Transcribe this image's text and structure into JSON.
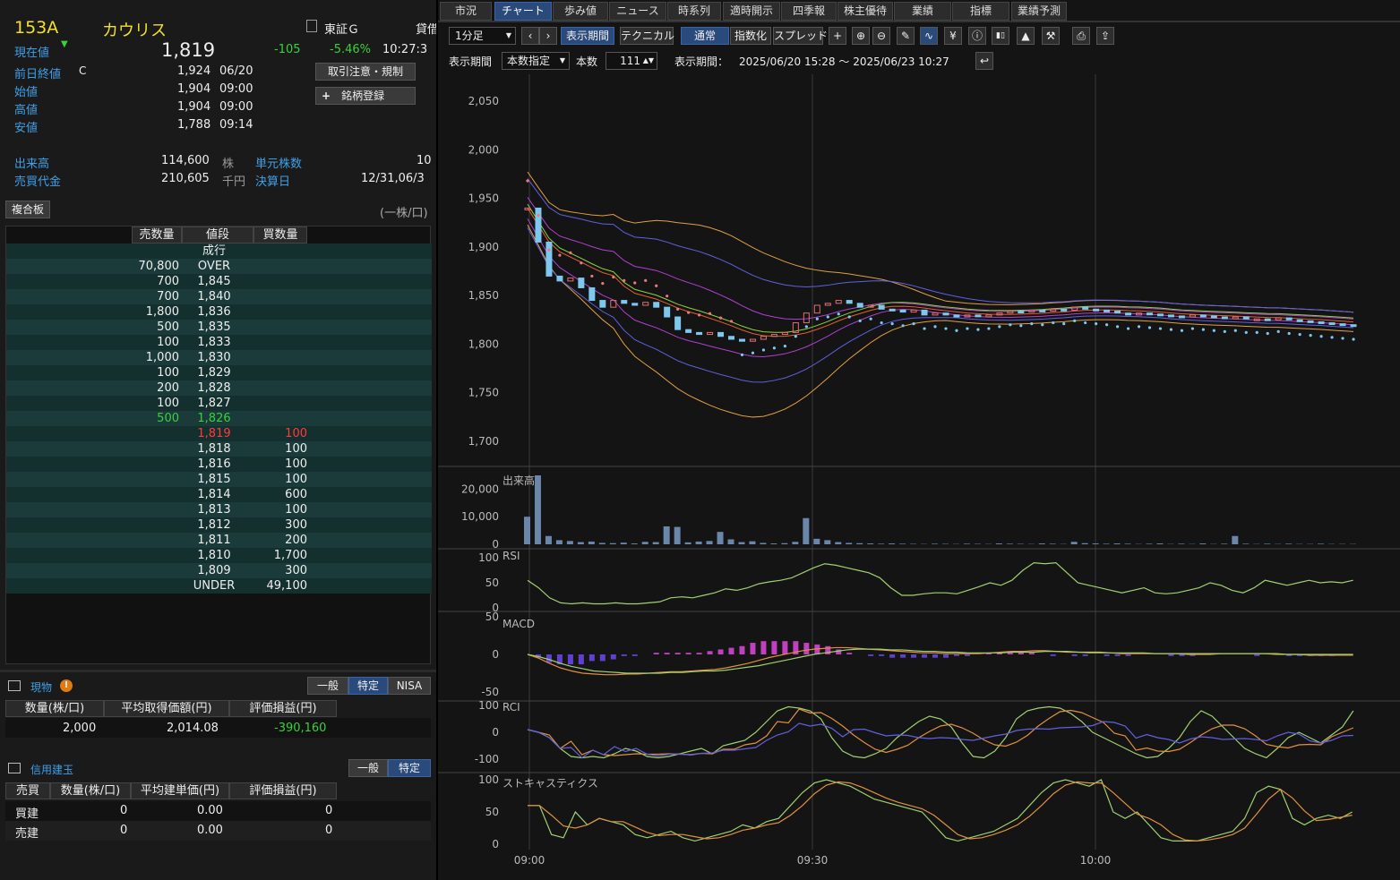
{
  "quote": {
    "code": "153A",
    "name": "カウリス",
    "market": "東証Ｇ",
    "lending": "貸借",
    "price_label": "現在値",
    "price": "1,819",
    "change": "-105",
    "change_pct": "-5.46%",
    "time": "10:27:3",
    "prev_label": "前日終値",
    "prev_flag": "C",
    "prev": "1,924",
    "prev_date": "06/20",
    "open_label": "始値",
    "open": "1,904",
    "open_time": "09:00",
    "high_label": "高値",
    "high": "1,904",
    "high_time": "09:00",
    "low_label": "安値",
    "low": "1,788",
    "low_time": "09:14",
    "vol_label": "出来高",
    "vol": "114,600",
    "vol_unit": "株",
    "turnover_label": "売買代金",
    "turnover": "210,605",
    "turnover_unit": "千円",
    "unit_label": "単元株数",
    "unit_value": "10",
    "settle_label": "決算日",
    "settle_value": "12/31,06/3",
    "btn_caution": "取引注意・規制",
    "btn_register": "銘柄登録"
  },
  "board": {
    "title": "複合板",
    "unit": "(一株/口)",
    "headers": [
      "売数量",
      "値段",
      "買数量"
    ],
    "rows": [
      {
        "sell": "",
        "price": "成行",
        "buy": "",
        "color": "w"
      },
      {
        "sell": "70,800",
        "price": "OVER",
        "buy": "",
        "color": "w"
      },
      {
        "sell": "700",
        "price": "1,845",
        "buy": "",
        "color": "w"
      },
      {
        "sell": "700",
        "price": "1,840",
        "buy": "",
        "color": "w"
      },
      {
        "sell": "1,800",
        "price": "1,836",
        "buy": "",
        "color": "w"
      },
      {
        "sell": "500",
        "price": "1,835",
        "buy": "",
        "color": "w"
      },
      {
        "sell": "100",
        "price": "1,833",
        "buy": "",
        "color": "w"
      },
      {
        "sell": "1,000",
        "price": "1,830",
        "buy": "",
        "color": "w"
      },
      {
        "sell": "100",
        "price": "1,829",
        "buy": "",
        "color": "w"
      },
      {
        "sell": "200",
        "price": "1,828",
        "buy": "",
        "color": "w"
      },
      {
        "sell": "100",
        "price": "1,827",
        "buy": "",
        "color": "w"
      },
      {
        "sell": "500",
        "price": "1,826",
        "buy": "",
        "color": "grn"
      },
      {
        "sell": "",
        "price": "1,819",
        "buy": "100",
        "color": "red"
      },
      {
        "sell": "",
        "price": "1,818",
        "buy": "100",
        "color": "w"
      },
      {
        "sell": "",
        "price": "1,816",
        "buy": "100",
        "color": "w"
      },
      {
        "sell": "",
        "price": "1,815",
        "buy": "100",
        "color": "w"
      },
      {
        "sell": "",
        "price": "1,814",
        "buy": "600",
        "color": "w"
      },
      {
        "sell": "",
        "price": "1,813",
        "buy": "100",
        "color": "w"
      },
      {
        "sell": "",
        "price": "1,812",
        "buy": "300",
        "color": "w"
      },
      {
        "sell": "",
        "price": "1,811",
        "buy": "200",
        "color": "w"
      },
      {
        "sell": "",
        "price": "1,810",
        "buy": "1,700",
        "color": "w"
      },
      {
        "sell": "",
        "price": "1,809",
        "buy": "300",
        "color": "w"
      },
      {
        "sell": "",
        "price": "UNDER",
        "buy": "49,100",
        "color": "w"
      }
    ]
  },
  "spot": {
    "title": "現物",
    "tabs": [
      "一般",
      "特定",
      "NISA"
    ],
    "headers": [
      "数量(株/口)",
      "平均取得価額(円)",
      "評価損益(円)"
    ],
    "qty": "2,000",
    "avg": "2,014.08",
    "pl": "-390,160"
  },
  "margin": {
    "title": "信用建玉",
    "tabs": [
      "一般",
      "特定"
    ],
    "headers": [
      "売買",
      "数量(株/口)",
      "平均建単価(円)",
      "評価損益(円)"
    ],
    "rows": [
      {
        "side": "買建",
        "qty": "0",
        "avg": "0.00",
        "pl": "0"
      },
      {
        "side": "売建",
        "qty": "0",
        "avg": "0.00",
        "pl": "0"
      }
    ]
  },
  "tabs": [
    "市況",
    "チャート",
    "歩み値",
    "ニュース",
    "時系列",
    "適時開示",
    "四季報",
    "株主優待",
    "業績",
    "指標",
    "業績予測"
  ],
  "toolbar": {
    "interval": "1分足",
    "period_btn": "表示期間",
    "technical_btn": "テクニカル",
    "normal_btn": "通常",
    "index_btn": "指数化",
    "spread_btn": "スプレッド",
    "period_label": "表示期間",
    "period_mode": "本数指定",
    "count_label": "本数",
    "count": "111",
    "range_label": "表示期間：",
    "range": "2025/06/20 15:28 〜 2025/06/23 10:27"
  },
  "chart_data": {
    "type": "line",
    "price_ticks": [
      "2,050",
      "2,000",
      "1,950",
      "1,900",
      "1,850",
      "1,800",
      "1,750",
      "1,700"
    ],
    "price_tick_values": [
      2050,
      2000,
      1950,
      1900,
      1850,
      1800,
      1750,
      1700
    ],
    "x_ticks": [
      "09:00",
      "09:30",
      "10:00"
    ],
    "volume_label": "出来高",
    "volume_ticks": [
      "20,000",
      "10,000",
      "0"
    ],
    "rsi_label": "RSI",
    "rsi_ticks": [
      "100",
      "50",
      "0"
    ],
    "macd_label": "MACD",
    "macd_ticks": [
      "50",
      "0",
      "-50"
    ],
    "rci_label": "RCI",
    "rci_ticks": [
      "100",
      "0",
      "-100"
    ],
    "stoch_label": "ストキャスティクス",
    "stoch_ticks": [
      "100",
      "50",
      "0"
    ],
    "close": [
      1940,
      1905,
      1870,
      1865,
      1868,
      1858,
      1845,
      1838,
      1845,
      1842,
      1840,
      1843,
      1838,
      1828,
      1815,
      1812,
      1810,
      1812,
      1808,
      1805,
      1803,
      1805,
      1808,
      1810,
      1812,
      1822,
      1832,
      1840,
      1842,
      1845,
      1842,
      1838,
      1840,
      1836,
      1835,
      1833,
      1835,
      1830,
      1832,
      1830,
      1828,
      1830,
      1829,
      1830,
      1832,
      1834,
      1833,
      1835,
      1834,
      1836,
      1835,
      1838,
      1836,
      1835,
      1834,
      1832,
      1830,
      1832,
      1831,
      1830,
      1829,
      1828,
      1830,
      1829,
      1828,
      1827,
      1828,
      1826,
      1826,
      1825,
      1827,
      1825,
      1824,
      1823,
      1822,
      1821,
      1820,
      1819
    ],
    "volume": [
      10000,
      25000,
      3000,
      1500,
      1200,
      800,
      1000,
      500,
      400,
      600,
      300,
      900,
      800,
      6500,
      6300,
      700,
      1000,
      1200,
      4500,
      1800,
      800,
      1100,
      500,
      300,
      400,
      900,
      9500,
      2000,
      1500,
      800,
      500,
      400,
      300,
      200,
      300,
      200,
      150,
      100,
      200,
      150,
      100,
      200,
      150,
      100,
      300,
      200,
      150,
      100,
      300,
      200,
      100,
      900,
      400,
      300,
      200,
      300,
      200,
      100,
      200,
      300,
      100,
      200,
      100,
      300,
      100,
      200,
      3000,
      200,
      100,
      200,
      100,
      200,
      100,
      100,
      200,
      100,
      100,
      100
    ],
    "rsi": [
      55,
      40,
      20,
      10,
      8,
      10,
      8,
      8,
      10,
      8,
      8,
      10,
      12,
      20,
      22,
      20,
      25,
      30,
      38,
      35,
      40,
      48,
      52,
      55,
      60,
      70,
      80,
      88,
      85,
      80,
      75,
      70,
      60,
      40,
      25,
      25,
      28,
      30,
      30,
      28,
      35,
      42,
      50,
      45,
      55,
      75,
      90,
      88,
      90,
      70,
      50,
      45,
      40,
      35,
      30,
      35,
      40,
      30,
      28,
      30,
      35,
      40,
      50,
      45,
      35,
      30,
      40,
      55,
      50,
      45,
      50,
      55,
      50,
      52,
      50,
      55
    ],
    "macd": [
      0,
      -5,
      -12,
      -18,
      -22,
      -25,
      -26,
      -27,
      -27,
      -26,
      -26,
      -25,
      -24,
      -23,
      -23,
      -22,
      -21,
      -20,
      -18,
      -15,
      -12,
      -8,
      -4,
      -1,
      2,
      5,
      7,
      8,
      9,
      9,
      8,
      7,
      6,
      5,
      4,
      3,
      2,
      2,
      1,
      1,
      1,
      1,
      2,
      3,
      4,
      4,
      5,
      5,
      4,
      3,
      3,
      2,
      2,
      2,
      1,
      1,
      1,
      1,
      1,
      1,
      0,
      0,
      0,
      1,
      1,
      1,
      1,
      1,
      0,
      0,
      0,
      -1,
      -1,
      -1,
      -1,
      -1
    ],
    "macd_signal": [
      0,
      -3,
      -7,
      -12,
      -16,
      -19,
      -22,
      -23,
      -24,
      -25,
      -25,
      -25,
      -25,
      -24,
      -24,
      -23,
      -22,
      -22,
      -21,
      -19,
      -17,
      -15,
      -12,
      -9,
      -6,
      -3,
      0,
      2,
      4,
      6,
      7,
      7,
      7,
      6,
      6,
      5,
      4,
      4,
      3,
      3,
      2,
      2,
      2,
      2,
      3,
      3,
      3,
      4,
      4,
      4,
      3,
      3,
      3,
      2,
      2,
      2,
      2,
      1,
      1,
      1,
      1,
      1,
      1,
      1,
      1,
      1,
      1,
      1,
      1,
      0,
      0,
      0,
      0,
      0,
      0,
      0
    ],
    "rci": [
      10,
      0,
      -20,
      -60,
      -90,
      -95,
      -90,
      -95,
      -80,
      -60,
      -70,
      -90,
      -95,
      -90,
      -80,
      -70,
      -60,
      -80,
      -50,
      -40,
      -30,
      0,
      40,
      80,
      95,
      90,
      80,
      50,
      -20,
      -70,
      -90,
      -95,
      -80,
      -60,
      -20,
      10,
      40,
      60,
      50,
      20,
      -40,
      -90,
      -95,
      -70,
      -20,
      50,
      80,
      90,
      95,
      90,
      70,
      40,
      0,
      -20,
      -40,
      -60,
      -80,
      -95,
      -90,
      -60,
      -20,
      40,
      80,
      60,
      20,
      -20,
      -60,
      -80,
      -95,
      -60,
      -20,
      0,
      -20,
      -40,
      -10,
      20,
      80
    ],
    "stoch": [
      60,
      60,
      15,
      10,
      50,
      30,
      40,
      35,
      30,
      15,
      10,
      15,
      20,
      10,
      5,
      10,
      15,
      20,
      30,
      25,
      35,
      40,
      60,
      80,
      95,
      100,
      95,
      90,
      80,
      70,
      65,
      60,
      55,
      50,
      30,
      10,
      5,
      10,
      15,
      20,
      30,
      40,
      60,
      80,
      95,
      100,
      95,
      90,
      100,
      50,
      40,
      50,
      30,
      10,
      5,
      5,
      5,
      10,
      15,
      20,
      40,
      80,
      90,
      85,
      40,
      30,
      40,
      45,
      40,
      50
    ]
  },
  "icons": [
    "crosshair-icon",
    "zoom-in-icon",
    "zoom-out-icon",
    "pencil-icon",
    "chart-line-icon",
    "yen-icon",
    "info-icon",
    "candle-icon",
    "area-icon",
    "wrench-icon",
    "print-icon",
    "export-icon"
  ]
}
